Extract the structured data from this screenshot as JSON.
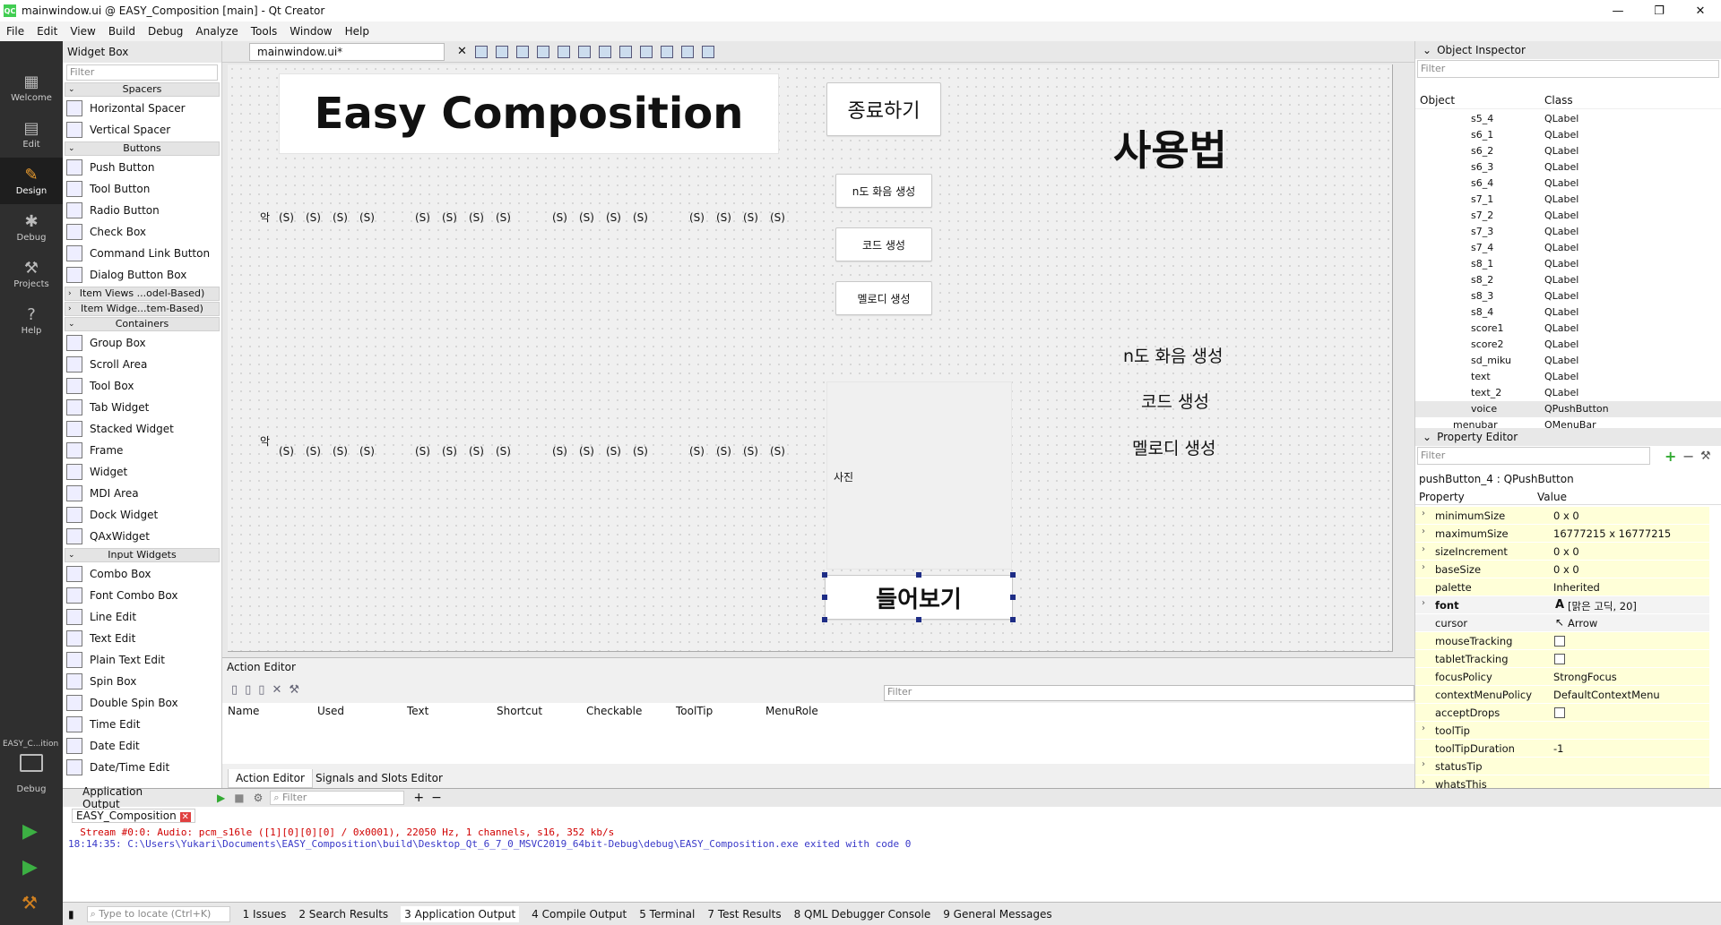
{
  "window": {
    "title": "mainwindow.ui @ EASY_Composition [main] - Qt Creator",
    "app_icon": "QC",
    "controls": [
      "—",
      "❐",
      "✕"
    ]
  },
  "menubar": [
    "File",
    "Edit",
    "View",
    "Build",
    "Debug",
    "Analyze",
    "Tools",
    "Window",
    "Help"
  ],
  "modebar": {
    "modes": [
      {
        "label": "Welcome",
        "icon": "grid-icon"
      },
      {
        "label": "Edit",
        "icon": "document-icon"
      },
      {
        "label": "Design",
        "icon": "pencil-icon"
      },
      {
        "label": "Debug",
        "icon": "bug-icon"
      },
      {
        "label": "Projects",
        "icon": "wrench-icon"
      },
      {
        "label": "Help",
        "icon": "help-icon"
      }
    ],
    "project": "EASY_C...ition",
    "target": "Debug"
  },
  "widget_box": {
    "title": "Widget Box",
    "filter_placeholder": "Filter",
    "categories": {
      "spacers": "Spacers",
      "buttons": "Buttons",
      "item_views": "Item Views ...odel-Based)",
      "item_widgets": "Item Widge...tem-Based)",
      "containers": "Containers",
      "input_widgets": "Input Widgets"
    },
    "spacers": [
      "Horizontal Spacer",
      "Vertical Spacer"
    ],
    "buttons": [
      "Push Button",
      "Tool Button",
      "Radio Button",
      "Check Box",
      "Command Link Button",
      "Dialog Button Box"
    ],
    "containers": [
      "Group Box",
      "Scroll Area",
      "Tool Box",
      "Tab Widget",
      "Stacked Widget",
      "Frame",
      "Widget",
      "MDI Area",
      "Dock Widget",
      "QAxWidget"
    ],
    "inputs": [
      "Combo Box",
      "Font Combo Box",
      "Line Edit",
      "Text Edit",
      "Plain Text Edit",
      "Spin Box",
      "Double Spin Box",
      "Time Edit",
      "Date Edit",
      "Date/Time Edit"
    ]
  },
  "editor": {
    "document": "mainwindow.ui*"
  },
  "form": {
    "title": "Easy Composition",
    "quit_button": "종료하기",
    "usage_heading": "사용법",
    "btn_ndo": "n도 화음 생성",
    "btn_chord": "코드 생성",
    "btn_melody": "멜로디 생성",
    "usage_ndo": "n도 화음 생성",
    "usage_chord": "코드 생성",
    "usage_melody": "멜로디 생성",
    "photo_label": "사진",
    "listen_button": "들어보기",
    "score1_label": "악",
    "score2_label": "악",
    "s": "(S)"
  },
  "action_editor": {
    "title": "Action Editor",
    "filter_placeholder": "Filter",
    "columns": [
      "Name",
      "Used",
      "Text",
      "Shortcut",
      "Checkable",
      "ToolTip",
      "MenuRole"
    ],
    "tabs": [
      "Action Editor",
      "Signals and Slots Editor"
    ]
  },
  "object_inspector": {
    "title": "Object Inspector",
    "filter_placeholder": "Filter",
    "columns": [
      "Object",
      "Class"
    ],
    "rows": [
      [
        "s5_4",
        "QLabel"
      ],
      [
        "s6_1",
        "QLabel"
      ],
      [
        "s6_2",
        "QLabel"
      ],
      [
        "s6_3",
        "QLabel"
      ],
      [
        "s6_4",
        "QLabel"
      ],
      [
        "s7_1",
        "QLabel"
      ],
      [
        "s7_2",
        "QLabel"
      ],
      [
        "s7_3",
        "QLabel"
      ],
      [
        "s7_4",
        "QLabel"
      ],
      [
        "s8_1",
        "QLabel"
      ],
      [
        "s8_2",
        "QLabel"
      ],
      [
        "s8_3",
        "QLabel"
      ],
      [
        "s8_4",
        "QLabel"
      ],
      [
        "score1",
        "QLabel"
      ],
      [
        "score2",
        "QLabel"
      ],
      [
        "sd_miku",
        "QLabel"
      ],
      [
        "text",
        "QLabel"
      ],
      [
        "text_2",
        "QLabel"
      ],
      [
        "voice",
        "QPushButton"
      ],
      [
        "menubar",
        "QMenuBar"
      ]
    ],
    "selected_row": 18
  },
  "property_editor": {
    "title": "Property Editor",
    "filter_placeholder": "Filter",
    "object": "pushButton_4 : QPushButton",
    "columns": [
      "Property",
      "Value"
    ],
    "rows": [
      {
        "name": "minimumSize",
        "value": "0 x 0",
        "expand": true
      },
      {
        "name": "maximumSize",
        "value": "16777215 x 16777215",
        "expand": true
      },
      {
        "name": "sizeIncrement",
        "value": "0 x 0",
        "expand": true
      },
      {
        "name": "baseSize",
        "value": "0 x 0",
        "expand": true
      },
      {
        "name": "palette",
        "value": "Inherited",
        "expand": false
      },
      {
        "name": "font",
        "value": "[맑은 고딕, 20]",
        "expand": true,
        "bold": true
      },
      {
        "name": "cursor",
        "value": "Arrow",
        "expand": false
      },
      {
        "name": "mouseTracking",
        "value": "",
        "check": true
      },
      {
        "name": "tabletTracking",
        "value": "",
        "check": true
      },
      {
        "name": "focusPolicy",
        "value": "StrongFocus",
        "expand": false
      },
      {
        "name": "contextMenuPolicy",
        "value": "DefaultContextMenu",
        "expand": false
      },
      {
        "name": "acceptDrops",
        "value": "",
        "check": true
      },
      {
        "name": "toolTip",
        "value": "",
        "expand": true
      },
      {
        "name": "toolTipDuration",
        "value": "-1",
        "expand": false
      },
      {
        "name": "statusTip",
        "value": "",
        "expand": true
      },
      {
        "name": "whatsThis",
        "value": "",
        "expand": true
      }
    ]
  },
  "app_output": {
    "title": "Application Output",
    "filter_placeholder": "Filter",
    "tab": "EASY_Composition",
    "line1": "  Stream #0:0: Audio: pcm_s16le ([1][0][0][0] / 0x0001), 22050 Hz, 1 channels, s16, 352 kb/s",
    "line2": "18:14:35: C:\\Users\\Yukari\\Documents\\EASY_Composition\\build\\Desktop_Qt_6_7_0_MSVC2019_64bit-Debug\\debug\\EASY_Composition.exe exited with code 0"
  },
  "statusbar": {
    "locate_placeholder": "Type to locate (Ctrl+K)",
    "panes": [
      "1  Issues",
      "2  Search Results",
      "3  Application Output",
      "4  Compile Output",
      "5  Terminal",
      "7  Test Results",
      "8  QML Debugger Console",
      "9  General Messages"
    ]
  },
  "colors": {
    "accent_green": "#41cd52",
    "error_red": "#d00000",
    "info_blue": "#3838c8",
    "modebar_bg": "#2f2f2f",
    "handle": "#1e2d86",
    "property_yellow": "#ffffd8"
  }
}
